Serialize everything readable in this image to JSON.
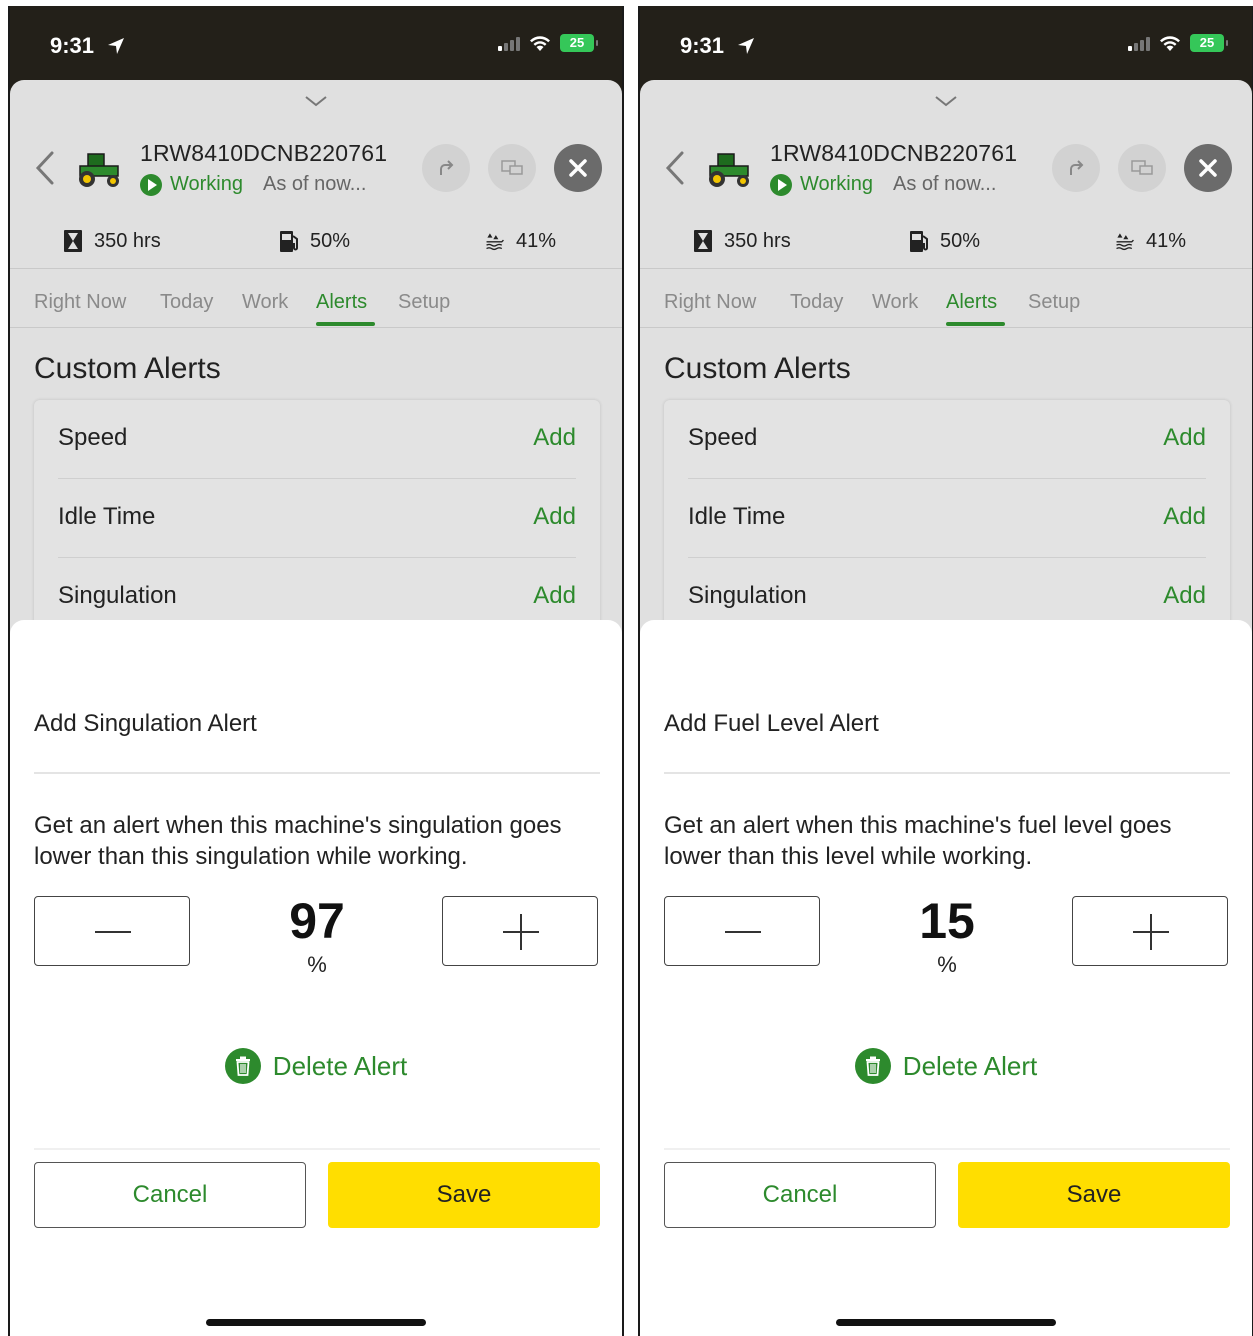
{
  "status_bar": {
    "time": "9:31",
    "battery": "25"
  },
  "header": {
    "machine_id": "1RW8410DCNB220761",
    "status": "Working",
    "as_of": "As of now...",
    "stats": {
      "hours": "350 hrs",
      "fuel": "50%",
      "def": "41%"
    }
  },
  "tabs": [
    "Right Now",
    "Today",
    "Work",
    "Alerts",
    "Setup"
  ],
  "active_tab": "Alerts",
  "section_title": "Custom Alerts",
  "alerts": [
    {
      "name": "Speed",
      "action": "Add"
    },
    {
      "name": "Idle Time",
      "action": "Add"
    },
    {
      "name": "Singulation",
      "action": "Add"
    }
  ],
  "screens": [
    {
      "modal_title": "Add Singulation Alert",
      "description": "Get an alert when this machine's singulation goes lower than this singulation while working.",
      "value": "97",
      "unit": "%"
    },
    {
      "modal_title": "Add Fuel Level Alert",
      "description": "Get an alert when this machine's fuel level goes lower than this level while working.",
      "value": "15",
      "unit": "%"
    }
  ],
  "delete_label": "Delete Alert",
  "cancel_label": "Cancel",
  "save_label": "Save",
  "colors": {
    "brand_green": "#2d8a2d",
    "save_yellow": "#ffde00"
  }
}
